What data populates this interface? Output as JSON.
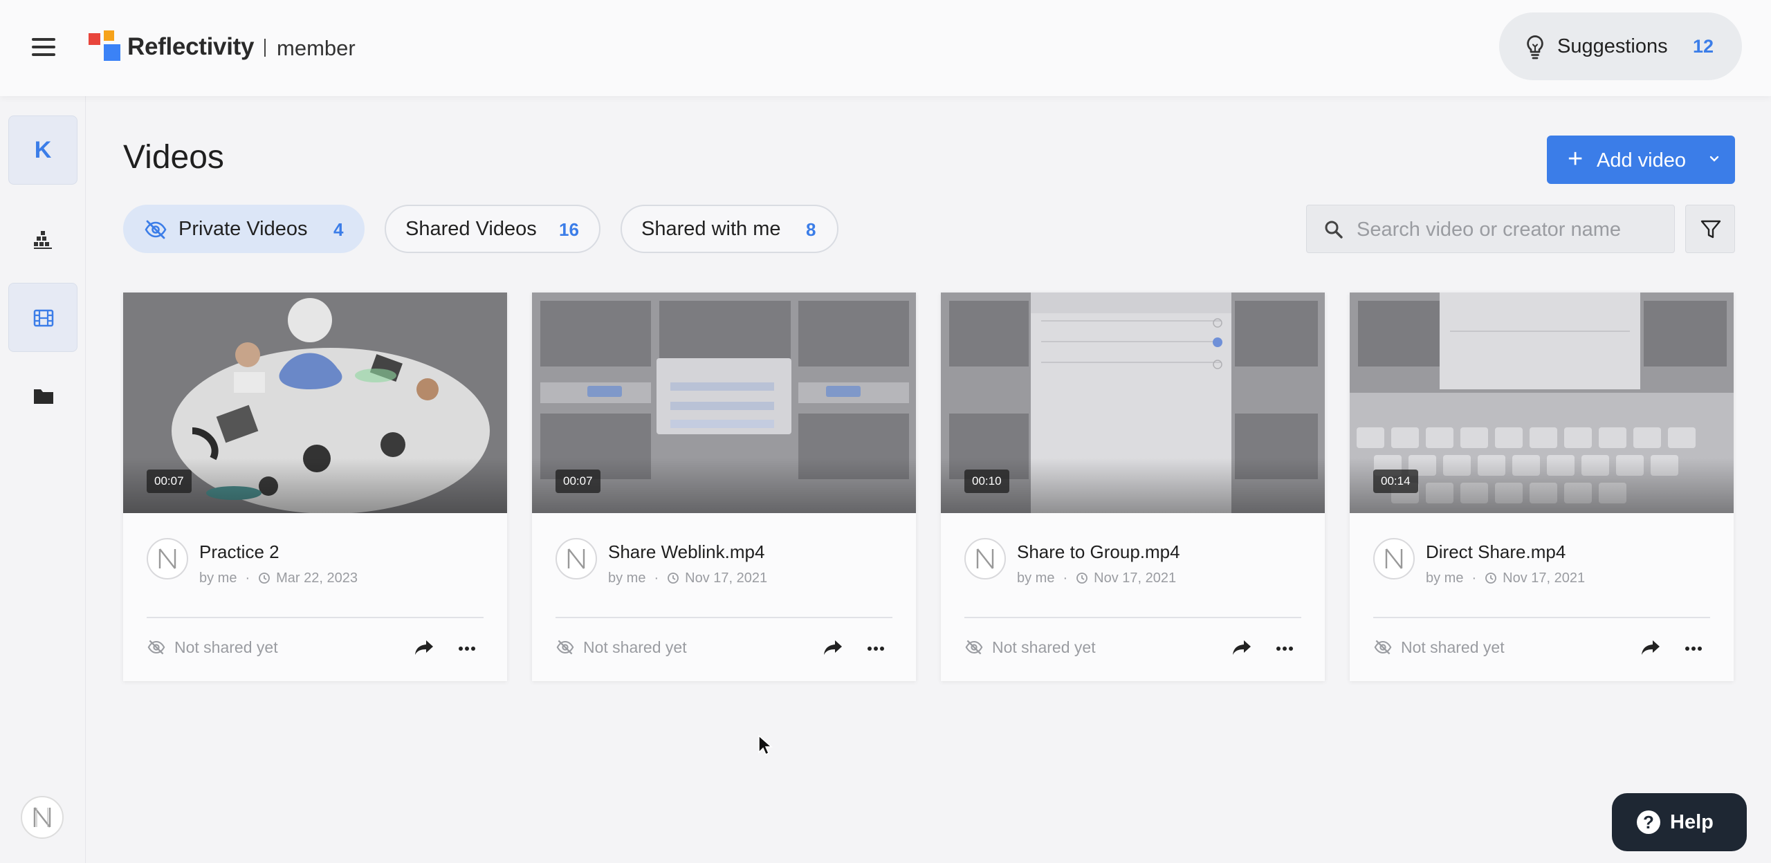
{
  "header": {
    "brand": "Reflectivity",
    "role": "member",
    "suggestions_label": "Suggestions",
    "suggestions_count": "12"
  },
  "sidebar": {
    "avatar_initial": "K",
    "items": [
      {
        "name": "analytics",
        "icon": "bar-chart-icon"
      },
      {
        "name": "videos",
        "icon": "film-icon",
        "active": true
      },
      {
        "name": "folders",
        "icon": "folder-icon"
      }
    ]
  },
  "main": {
    "title": "Videos",
    "add_video_label": "Add video",
    "tabs": [
      {
        "label": "Private Videos",
        "count": "4",
        "active": true
      },
      {
        "label": "Shared Videos",
        "count": "16"
      },
      {
        "label": "Shared with me",
        "count": "8"
      }
    ],
    "search_placeholder": "Search video or creator name"
  },
  "videos": [
    {
      "title": "Practice 2",
      "duration": "00:07",
      "by": "by me",
      "date": "Mar 22, 2023",
      "share_status": "Not shared yet"
    },
    {
      "title": "Share Weblink.mp4",
      "duration": "00:07",
      "by": "by me",
      "date": "Nov 17, 2021",
      "share_status": "Not shared yet"
    },
    {
      "title": "Share to Group.mp4",
      "duration": "00:10",
      "by": "by me",
      "date": "Nov 17, 2021",
      "share_status": "Not shared yet"
    },
    {
      "title": "Direct Share.mp4",
      "duration": "00:14",
      "by": "by me",
      "date": "Nov 17, 2021",
      "share_status": "Not shared yet"
    }
  ],
  "help_label": "Help",
  "colors": {
    "accent": "#3b7de8",
    "active_tab_bg": "#dce6f7",
    "help_bg": "#1e2733",
    "logo_red": "#e8453c",
    "logo_orange": "#f6a21a",
    "logo_blue": "#3b82f6"
  }
}
